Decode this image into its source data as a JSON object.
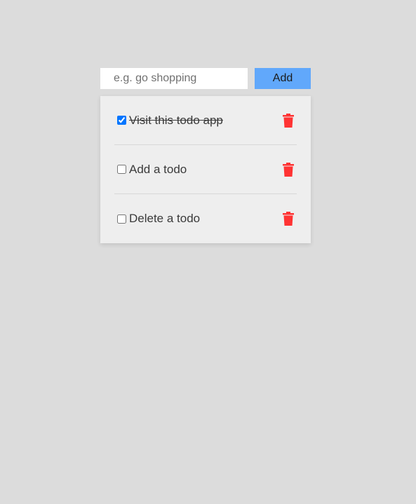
{
  "form": {
    "placeholder": "e.g. go shopping",
    "value": "",
    "add_label": "Add"
  },
  "todos": [
    {
      "label": "Visit this todo app",
      "done": true,
      "delete_icon": "trash-icon"
    },
    {
      "label": "Add a todo",
      "done": false,
      "delete_icon": "trash-icon"
    },
    {
      "label": "Delete a todo",
      "done": false,
      "delete_icon": "trash-icon"
    }
  ],
  "colors": {
    "background": "#dcdcdc",
    "accent": "#61a8fb",
    "delete": "#ff3333",
    "card": "#eeeeee"
  }
}
